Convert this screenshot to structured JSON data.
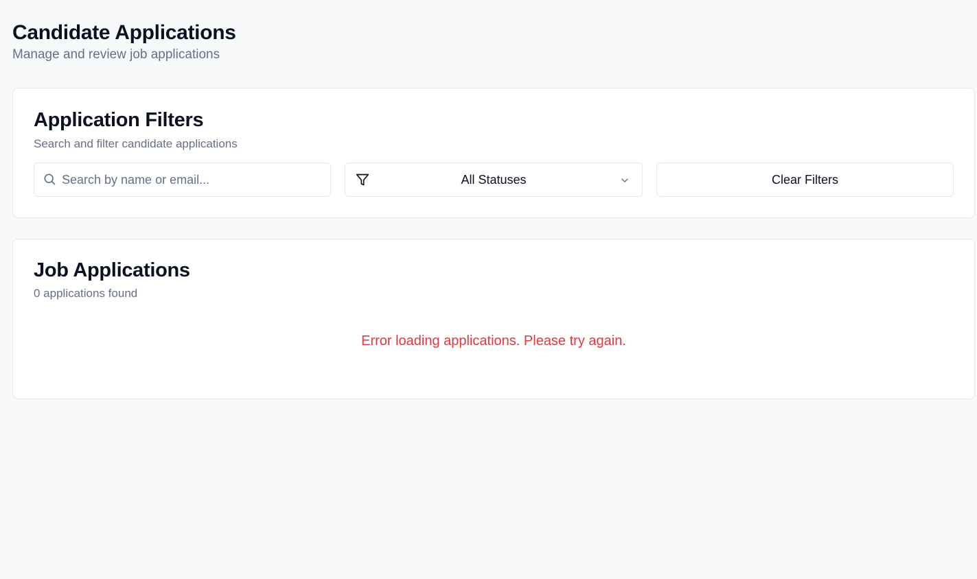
{
  "header": {
    "title": "Candidate Applications",
    "subtitle": "Manage and review job applications"
  },
  "filters": {
    "title": "Application Filters",
    "description": "Search and filter candidate applications",
    "search": {
      "placeholder": "Search by name or email...",
      "value": "",
      "icon": "search-icon"
    },
    "status_select": {
      "selected": "All Statuses",
      "icon": "filter-icon",
      "chevron": "chevron-down-icon"
    },
    "clear_label": "Clear Filters"
  },
  "applications": {
    "title": "Job Applications",
    "count_text": "0 applications found",
    "error_text": "Error loading applications. Please try again."
  },
  "colors": {
    "background": "#f8f9fb",
    "card": "#ffffff",
    "border": "#e4e7ec",
    "text_primary": "#0b1120",
    "text_muted": "#667085",
    "error": "#e0393e"
  }
}
